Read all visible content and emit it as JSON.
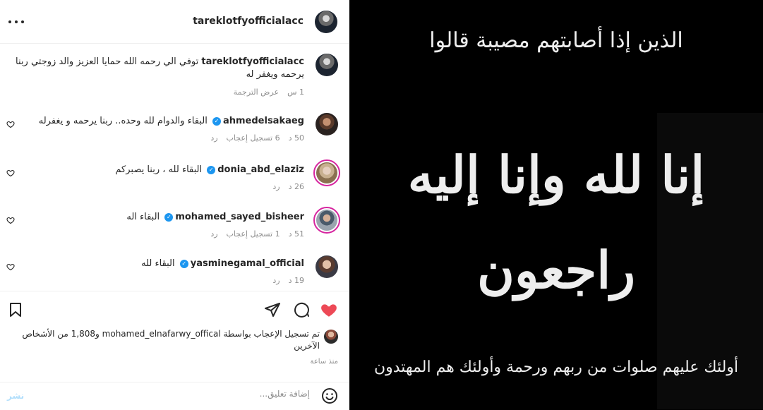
{
  "header": {
    "username": "tareklotfyofficialacc"
  },
  "caption": {
    "username": "tareklotfyofficialacc",
    "text": "توفي الي رحمه الله حمايا العزيز والد زوجتي ربنا يرحمه ويغفر له",
    "time": "1 س",
    "translate": "عرض الترجمة"
  },
  "comments": [
    {
      "username": "ahmedelsakaeg",
      "text": "البقاء والدوام لله وحده.. ربنا يرحمه و يغفرله",
      "time": "50 د",
      "likes": "6 تسجيل إعجاب",
      "reply": "رد"
    },
    {
      "username": "donia_abd_elaziz",
      "text": "البقاء لله ، ربنا يصبركم",
      "time": "26 د",
      "likes": "",
      "reply": "رد"
    },
    {
      "username": "mohamed_sayed_bisheer",
      "text": "البقاء اله",
      "time": "51 د",
      "likes": "1 تسجيل إعجاب",
      "reply": "رد"
    },
    {
      "username": "yasminegamal_official",
      "text": "البقاء لله",
      "time": "19 د",
      "likes": "",
      "reply": "رد"
    }
  ],
  "likes_summary": {
    "text": "تم تسجيل الإعجاب بواسطة mohamed_elnafarwy_offical و1,808 من الأشخاص الآخرين"
  },
  "time_ago": "منذ ساعة",
  "comment_box": {
    "placeholder": "إضافة تعليق...",
    "post_label": "نشر"
  },
  "post_image": {
    "line1": "الذين إذا أصابتهم مصيبة قالوا",
    "line2": "إنا لله وإنا إليه",
    "line3": "راجعون",
    "line4": "أولئك عليهم صلوات من ربهم ورحمة وأولئك هم المهتدون"
  },
  "colors": {
    "like_red": "#ed4956",
    "verified_blue": "#1c96f0",
    "post_button": "#b2dffc"
  }
}
